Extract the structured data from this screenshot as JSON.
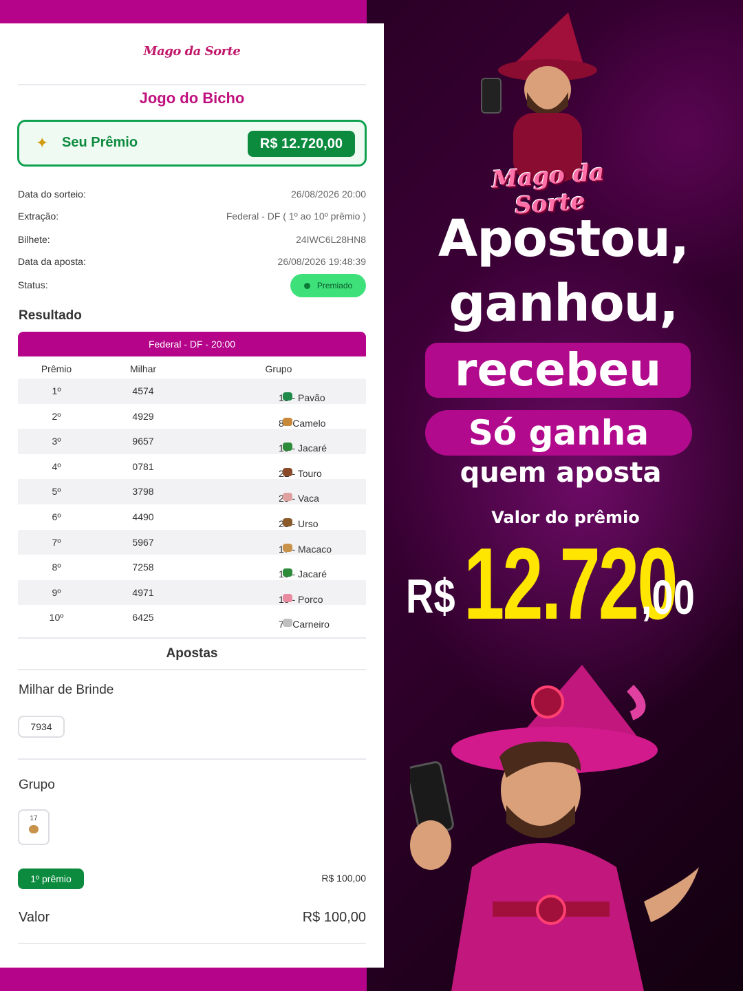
{
  "app": {
    "logo": "Mago da Sorte",
    "title": "Jogo do Bicho"
  },
  "prize": {
    "label": "Seu Prêmio",
    "amount": "R$ 12.720,00"
  },
  "details": [
    {
      "key": "Data do sorteio:",
      "value": "26/08/2026 20:00"
    },
    {
      "key": "Extração:",
      "value": "Federal - DF ( 1º ao 10º prêmio )"
    },
    {
      "key": "Bilhete:",
      "value": "24IWC6L28HN8"
    },
    {
      "key": "Data da aposta:",
      "value": "26/08/2026 19:48:39"
    },
    {
      "key": "Status:",
      "value": "Premiado"
    }
  ],
  "result": {
    "heading": "Resultado",
    "draw": "Federal - DF - 20:00",
    "columns": [
      "Prêmio",
      "Milhar",
      "Grupo"
    ],
    "rows": [
      {
        "premio": "1º",
        "milhar": "4574",
        "grupo": "19 - Pavão",
        "icon": "peacock-icon",
        "color": "#1f8a4a"
      },
      {
        "premio": "2º",
        "milhar": "4929",
        "grupo": "8 - Camelo",
        "icon": "camel-icon",
        "color": "#c88a3a"
      },
      {
        "premio": "3º",
        "milhar": "9657",
        "grupo": "15 - Jacaré",
        "icon": "alligator-icon",
        "color": "#2e8b3a"
      },
      {
        "premio": "4º",
        "milhar": "0781",
        "grupo": "21 - Touro",
        "icon": "bull-icon",
        "color": "#8a4a2a"
      },
      {
        "premio": "5º",
        "milhar": "3798",
        "grupo": "25 - Vaca",
        "icon": "cow-icon",
        "color": "#e0a0a0"
      },
      {
        "premio": "6º",
        "milhar": "4490",
        "grupo": "23 - Urso",
        "icon": "bear-icon",
        "color": "#8a5a2a"
      },
      {
        "premio": "7º",
        "milhar": "5967",
        "grupo": "17 - Macaco",
        "icon": "monkey-icon",
        "color": "#c9924a"
      },
      {
        "premio": "8º",
        "milhar": "7258",
        "grupo": "15 - Jacaré",
        "icon": "alligator-icon",
        "color": "#2e8b3a"
      },
      {
        "premio": "9º",
        "milhar": "4971",
        "grupo": "18 - Porco",
        "icon": "pig-icon",
        "color": "#e88aa0"
      },
      {
        "premio": "10º",
        "milhar": "6425",
        "grupo": "7 - Carneiro",
        "icon": "ram-icon",
        "color": "#bfbfbf"
      }
    ]
  },
  "bets": {
    "heading": "Apostas",
    "milhar_brinde_label": "Milhar de Brinde",
    "milhar_brinde_value": "7934",
    "grupo_label": "Grupo",
    "grupo_value": "17",
    "premio_tag": "1º prêmio",
    "line_amount": "R$ 100,00",
    "valor_label": "Valor",
    "valor_amount": "R$ 100,00"
  },
  "promo": {
    "logo": "Mago da Sorte",
    "line1": "Apostou,",
    "line2": "ganhou,",
    "line3": "recebeu",
    "line4": "Só ganha",
    "line5": "quem aposta",
    "prize_caption": "Valor do prêmio",
    "currency": "R$",
    "amount_big": "12.720",
    "amount_cents": ",00"
  },
  "colors": {
    "brand_magenta": "#b5048a",
    "success_green": "#0c8a3e",
    "prize_yellow": "#ffe600"
  }
}
